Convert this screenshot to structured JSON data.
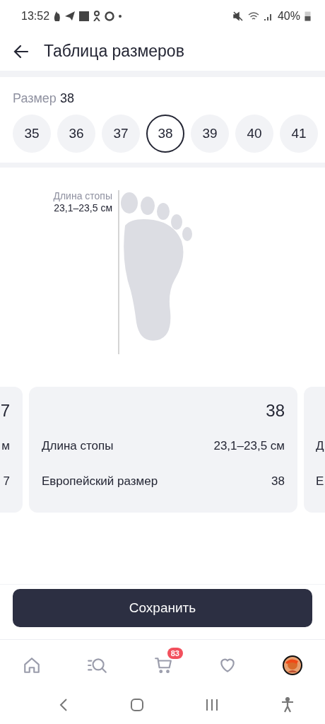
{
  "status_bar": {
    "time": "13:52",
    "battery": "40%"
  },
  "header": {
    "title": "Таблица размеров"
  },
  "size_picker": {
    "label": "Размер",
    "value": "38",
    "sizes": [
      {
        "label": "35",
        "selected": false
      },
      {
        "label": "36",
        "selected": false
      },
      {
        "label": "37",
        "selected": false
      },
      {
        "label": "38",
        "selected": true
      },
      {
        "label": "39",
        "selected": false
      },
      {
        "label": "40",
        "selected": false
      },
      {
        "label": "41",
        "selected": false
      }
    ]
  },
  "foot_diagram": {
    "label": "Длина стопы",
    "value": "23,1–23,5 см"
  },
  "cards": [
    {
      "kind": "partial-left",
      "title": "7",
      "rows": [
        {
          "value": "м"
        },
        {
          "value": "7"
        }
      ]
    },
    {
      "kind": "full",
      "title": "38",
      "rows": [
        {
          "label": "Длина стопы",
          "value": "23,1–23,5 см"
        },
        {
          "label": "Европейский размер",
          "value": "38"
        }
      ]
    },
    {
      "kind": "partial-right",
      "rows": [
        {
          "label": "Д"
        },
        {
          "label": "Е"
        }
      ]
    }
  ],
  "save_button": "Сохранить",
  "bottom_nav": {
    "cart_badge": "83"
  }
}
